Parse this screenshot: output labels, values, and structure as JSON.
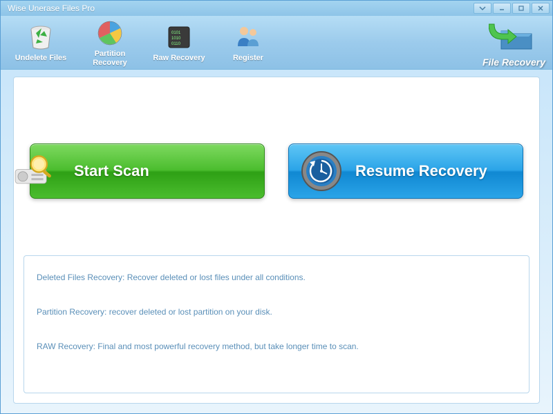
{
  "window": {
    "title": "Wise Unerase Files Pro"
  },
  "toolbar": {
    "items": [
      {
        "label": "Undelete Files"
      },
      {
        "label": "Partition\nRecovery"
      },
      {
        "label": "Raw Recovery"
      },
      {
        "label": "Register"
      }
    ],
    "brand": "File Recovery"
  },
  "main": {
    "start_scan": "Start  Scan",
    "resume_recovery": "Resume Recovery"
  },
  "info": {
    "line1": "Deleted Files Recovery: Recover deleted or lost files  under all conditions.",
    "line2": "Partition Recovery: recover deleted or lost partition on your disk.",
    "line3": "RAW Recovery: Final and most powerful recovery method, but take longer time to scan."
  }
}
